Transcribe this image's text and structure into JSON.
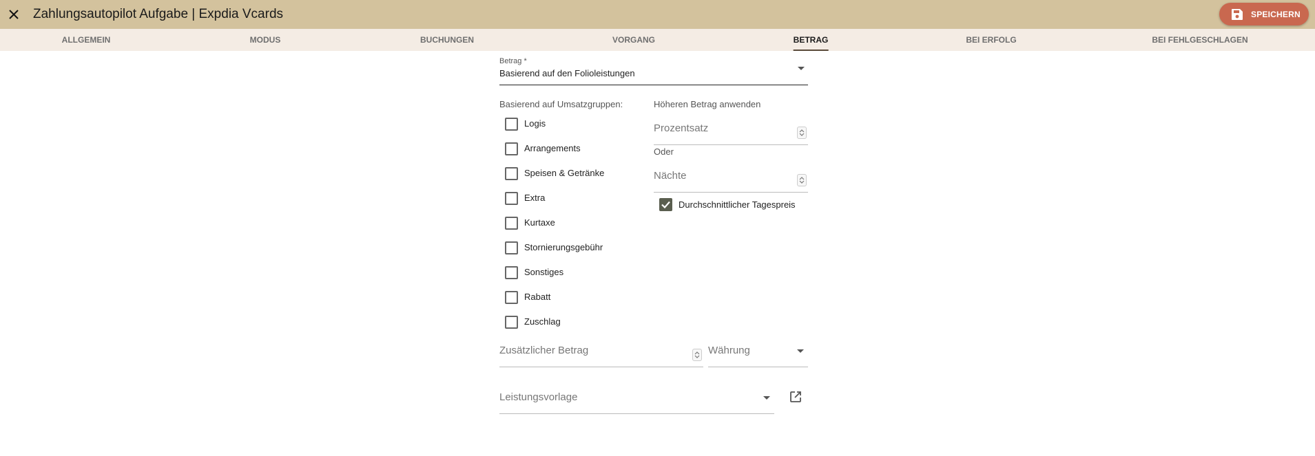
{
  "app": {
    "title": "Zahlungsautopilot Aufgabe | Expdia Vcards",
    "save_label": "SPEICHERN"
  },
  "tabs": [
    {
      "label": "ALLGEMEIN"
    },
    {
      "label": "MODUS"
    },
    {
      "label": "BUCHUNGEN"
    },
    {
      "label": "VORGANG"
    },
    {
      "label": "BETRAG",
      "active": true
    },
    {
      "label": "BEI ERFOLG"
    },
    {
      "label": "BEI FEHLGESCHLAGEN"
    }
  ],
  "betrag": {
    "label": "Betrag *",
    "value": "Basierend auf den Folioleistungen"
  },
  "umsatzgruppen": {
    "label": "Basierend auf Umsatzgruppen:",
    "items": [
      {
        "label": "Logis",
        "checked": false
      },
      {
        "label": "Arrangements",
        "checked": false
      },
      {
        "label": "Speisen & Getränke",
        "checked": false
      },
      {
        "label": "Extra",
        "checked": false
      },
      {
        "label": "Kurtaxe",
        "checked": false
      },
      {
        "label": "Stornierungsgebühr",
        "checked": false
      },
      {
        "label": "Sonstiges",
        "checked": false
      },
      {
        "label": "Rabatt",
        "checked": false
      },
      {
        "label": "Zuschlag",
        "checked": false
      }
    ]
  },
  "hoeherer_betrag": {
    "label": "Höheren Betrag anwenden",
    "prozentsatz_placeholder": "Prozentsatz",
    "oder": "Oder",
    "naechte_placeholder": "Nächte",
    "tagespreis_label": "Durchschnittlicher Tagespreis",
    "tagespreis_checked": true
  },
  "zusaetzlich": {
    "betrag_placeholder": "Zusätzlicher Betrag",
    "waehrung_placeholder": "Währung"
  },
  "leistungsvorlage": {
    "placeholder": "Leistungsvorlage"
  },
  "colors": {
    "topbar": "#d3c29d",
    "tabbar": "#f4ece4",
    "save_button": "#c9684f",
    "checkbox_checked": "#5a5e4f"
  }
}
